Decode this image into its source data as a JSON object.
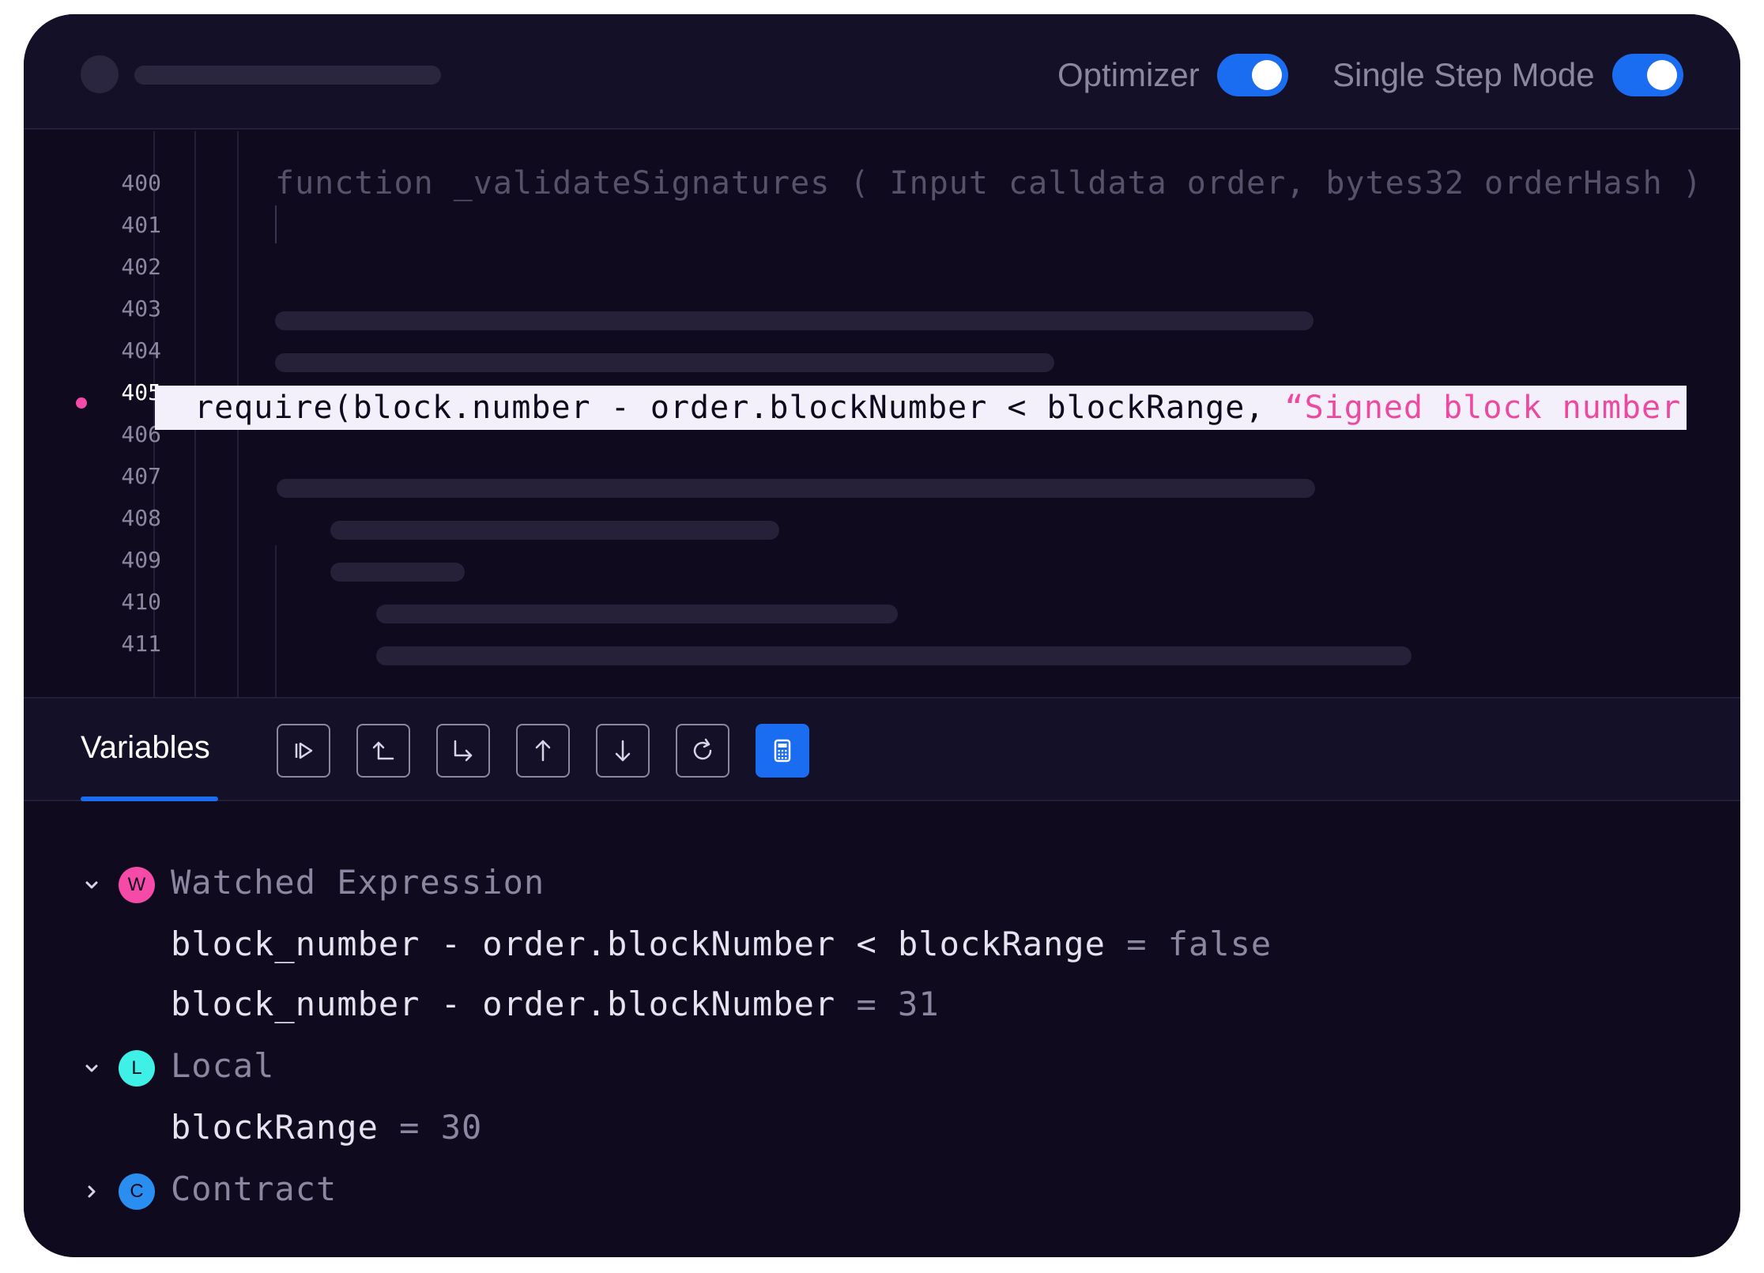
{
  "header": {
    "optimizer_label": "Optimizer",
    "optimizer_on": true,
    "single_step_label": "Single Step Mode",
    "single_step_on": true
  },
  "editor": {
    "line_numbers": [
      "400",
      "401",
      "402",
      "403",
      "404",
      "405",
      "406",
      "407",
      "408",
      "409",
      "410",
      "411"
    ],
    "active_line": "405",
    "function_signature": "function _validateSignatures ( Input calldata order, bytes32 orderHash )",
    "highlight_code": "require(block.number - order.blockNumber < blockRange, ",
    "highlight_string": "“Signed block number"
  },
  "toolbar": {
    "tab_label": "Variables",
    "buttons": [
      "continue",
      "step-back",
      "step-over",
      "step-out",
      "step-into",
      "restart",
      "calculator"
    ]
  },
  "variables": {
    "groups": [
      {
        "badge": "W",
        "label": "Watched Expression",
        "expanded": true,
        "items": [
          {
            "expr": "block_number - order.blockNumber < blockRange",
            "eq": "=",
            "value": "false"
          },
          {
            "expr": "block_number - order.blockNumber",
            "eq": "=",
            "value": "31"
          }
        ]
      },
      {
        "badge": "L",
        "label": "Local",
        "expanded": true,
        "items": [
          {
            "expr": "blockRange",
            "eq": "=",
            "value": "30"
          }
        ]
      },
      {
        "badge": "C",
        "label": "Contract",
        "expanded": false,
        "items": []
      }
    ]
  },
  "colors": {
    "background": "#0f0a1e",
    "accent": "#1a6cf0",
    "pink": "#f54aa8",
    "cyan": "#3ff0e6",
    "blue_badge": "#2a8ef0",
    "highlight_bg": "#f3f0fb"
  }
}
